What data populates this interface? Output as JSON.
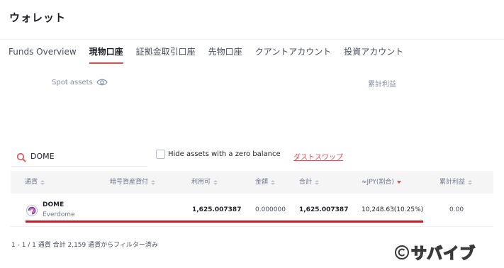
{
  "header": {
    "title": "ウォレット"
  },
  "tabs": [
    {
      "label": "Funds Overview",
      "active": false
    },
    {
      "label": "現物口座",
      "active": true
    },
    {
      "label": "証拠金取引口座",
      "active": false
    },
    {
      "label": "先物口座",
      "active": false
    },
    {
      "label": "クアントアカウント",
      "active": false
    },
    {
      "label": "投資アカウント",
      "active": false
    }
  ],
  "summary": {
    "spot_assets_label": "Spot assets",
    "spot_assets_icon": "eye-icon",
    "cumulative_pnl_label": "累計利益"
  },
  "filters": {
    "search_icon": "search-icon",
    "search_value": "DOME",
    "hide_zero_label": "Hide assets with a zero balance",
    "hide_zero_checked": false,
    "dust_swap_label": "ダストスワップ"
  },
  "table": {
    "columns": [
      {
        "label": "通貨",
        "sort": "both"
      },
      {
        "label": "暗号資産貸付",
        "sort": "both"
      },
      {
        "label": "利用可",
        "sort": "both"
      },
      {
        "label": "金額",
        "sort": "both"
      },
      {
        "label": "合計",
        "sort": "both"
      },
      {
        "label": "≈JPY(割合)",
        "sort": "desc"
      },
      {
        "label": "累計利益",
        "sort": "both"
      }
    ],
    "rows": [
      {
        "symbol": "DOME",
        "name": "Everdome",
        "logo_icon": "everdome-logo-icon",
        "lending": "",
        "available": "1,625.007387",
        "amount": "0.000000",
        "total": "1,625.007387",
        "jpy": "10,248.63(10.25%)",
        "cumulative_pnl": "0.00"
      }
    ]
  },
  "footer": {
    "pagination_text": "1 - 1 / 1 通貨 合計 2,159 通貨からフィルター済み"
  },
  "watermark": {
    "text": "サバイブ",
    "icon": "copyright-icon"
  },
  "colors": {
    "accent": "#e24e53",
    "highlight_line": "#e8101a",
    "header_bg": "#f5f5f5",
    "muted_text": "#848e9c"
  }
}
